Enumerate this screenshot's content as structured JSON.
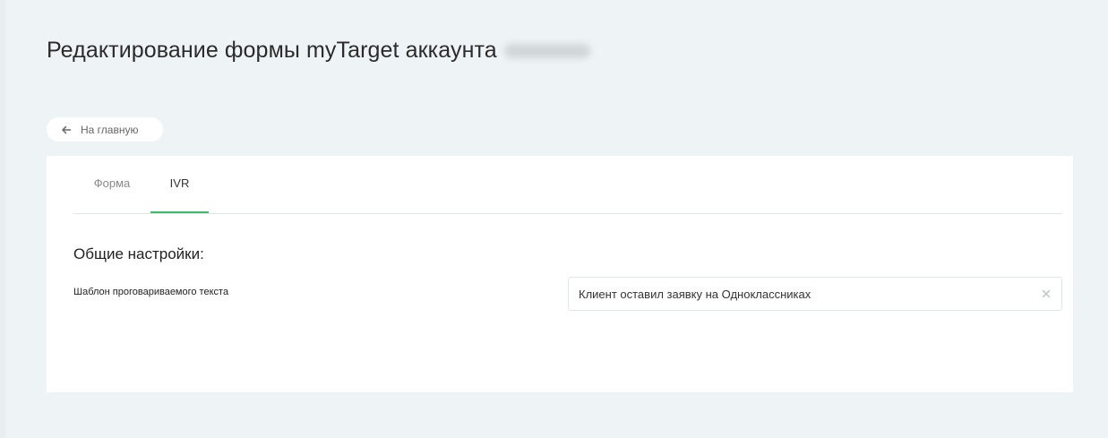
{
  "header": {
    "title": "Редактирование формы myTarget аккаунта"
  },
  "nav": {
    "back_label": "На главную",
    "back_icon": "arrow-left-icon"
  },
  "tabs": [
    {
      "label": "Форма",
      "active": false
    },
    {
      "label": "IVR",
      "active": true
    }
  ],
  "section": {
    "title": "Общие настройки:"
  },
  "field": {
    "label": "Шаблон проговариваемого текста",
    "value": "Клиент оставил заявку на Одноклассниках",
    "clear_icon": "close-icon"
  },
  "colors": {
    "background": "#eef4f5",
    "accent": "#3dbb6c",
    "card": "#ffffff"
  }
}
